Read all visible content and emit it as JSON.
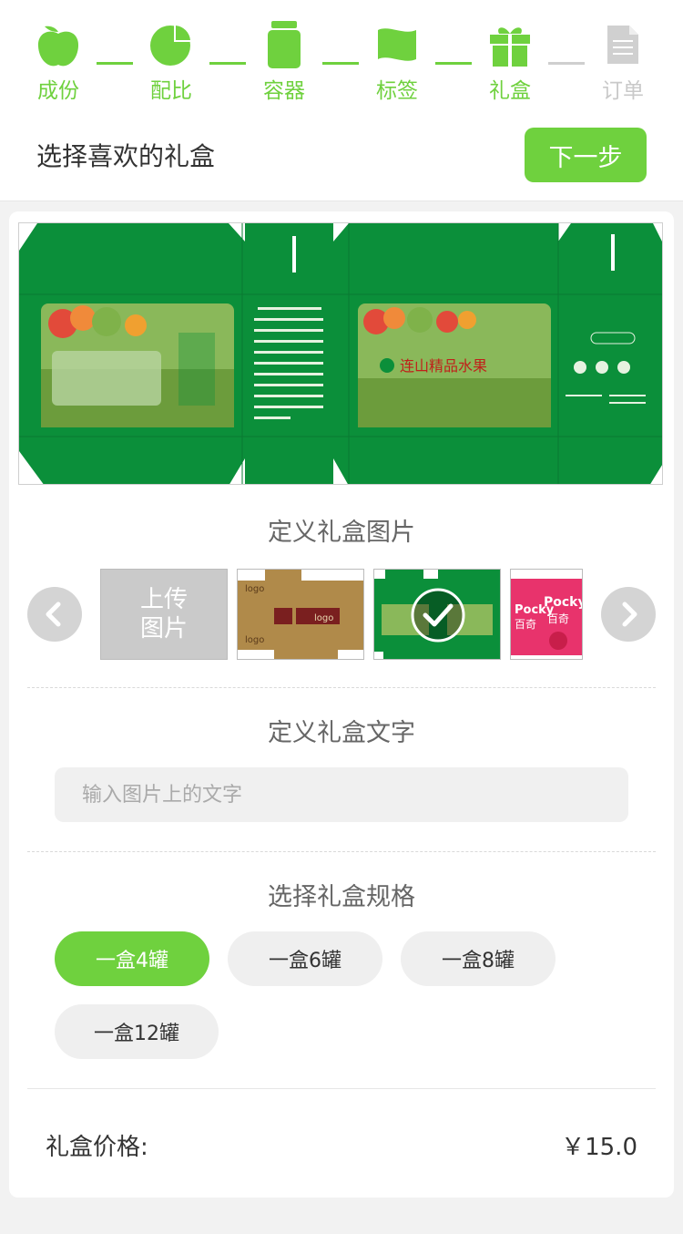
{
  "steps": [
    {
      "label": "成份",
      "icon": "apple-icon",
      "state": "done"
    },
    {
      "label": "配比",
      "icon": "pie-chart-icon",
      "state": "done"
    },
    {
      "label": "容器",
      "icon": "jar-icon",
      "state": "done"
    },
    {
      "label": "标签",
      "icon": "flag-label-icon",
      "state": "done"
    },
    {
      "label": "礼盒",
      "icon": "gift-box-icon",
      "state": "current"
    },
    {
      "label": "订单",
      "icon": "document-icon",
      "state": "pending"
    }
  ],
  "header": {
    "title": "选择喜欢的礼盒",
    "next_label": "下一步"
  },
  "preview": {
    "box_title": "连山精品水果"
  },
  "image_section": {
    "title": "定义礼盒图片",
    "upload_label_line1": "上传",
    "upload_label_line2": "图片"
  },
  "thumbs": [
    {
      "name": "brown-box-template",
      "logo_text": "logo"
    },
    {
      "name": "green-fruit-box-template",
      "selected": true
    },
    {
      "name": "pocky-pink-box-template",
      "brand": "Pocky",
      "cn": "百奇"
    }
  ],
  "text_section": {
    "title": "定义礼盒文字",
    "placeholder": "输入图片上的文字",
    "value": ""
  },
  "spec_section": {
    "title": "选择礼盒规格",
    "options": [
      "一盒4罐",
      "一盒6罐",
      "一盒8罐",
      "一盒12罐"
    ],
    "selected": "一盒4罐"
  },
  "price": {
    "label": "礼盒价格:",
    "value": "￥15.0"
  },
  "colors": {
    "accent": "#6fd13e",
    "box_green": "#0b8f3a",
    "inactive": "#c9c9c9"
  }
}
